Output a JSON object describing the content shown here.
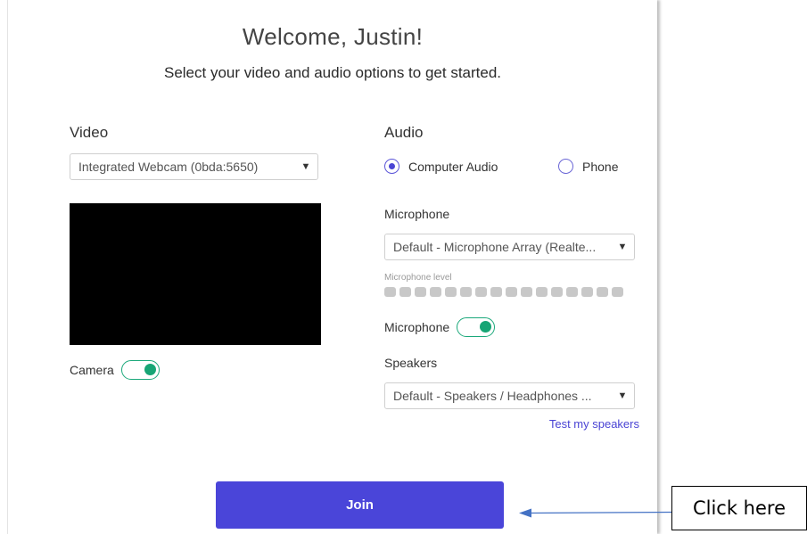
{
  "header": {
    "title": "Welcome, Justin!",
    "subtitle": "Select your video and audio options to get started."
  },
  "video": {
    "label": "Video",
    "camera_select_value": "Integrated Webcam (0bda:5650)",
    "camera_toggle_label": "Camera",
    "camera_on": true
  },
  "audio": {
    "label": "Audio",
    "options": [
      {
        "label": "Computer Audio",
        "selected": true
      },
      {
        "label": "Phone",
        "selected": false
      }
    ],
    "microphone_heading": "Microphone",
    "microphone_select_value": "Default - Microphone Array (Realte...",
    "microphone_level_label": "Microphone level",
    "microphone_level_segments": 16,
    "microphone_level_active": 0,
    "microphone_toggle_label": "Microphone",
    "microphone_on": true,
    "speakers_heading": "Speakers",
    "speakers_select_value": "Default - Speakers / Headphones ...",
    "test_speakers_link": "Test my speakers"
  },
  "actions": {
    "join_label": "Join"
  },
  "annotation": {
    "callout_text": "Click here"
  },
  "colors": {
    "accent": "#4a45d9",
    "toggle_on": "#17a575"
  }
}
